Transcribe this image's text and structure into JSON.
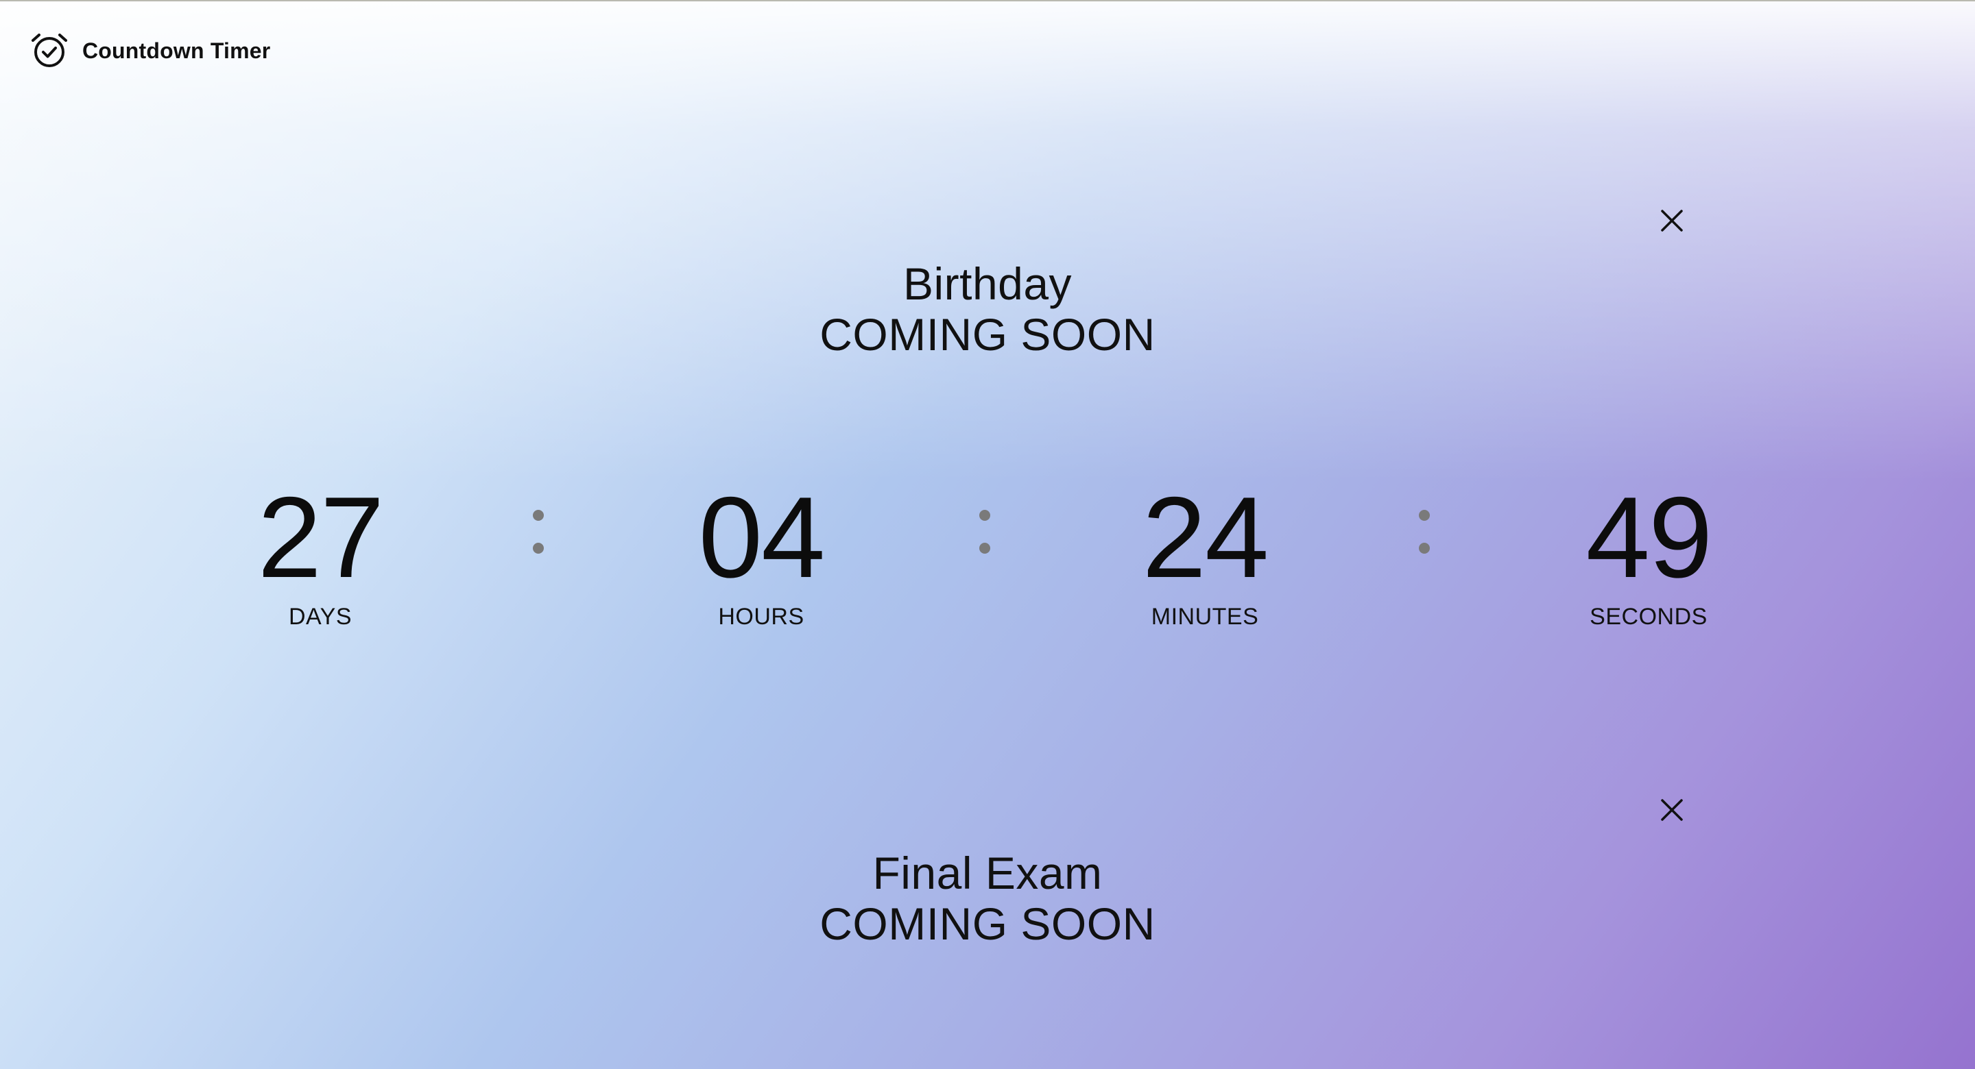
{
  "app": {
    "title": "Countdown Timer",
    "logo_icon": "alarm-clock-check-icon"
  },
  "countdowns": [
    {
      "title": "Birthday",
      "status": "COMING SOON",
      "close_icon": "close-icon",
      "timer": {
        "days": "27",
        "hours": "04",
        "minutes": "24",
        "seconds": "49",
        "labels": {
          "days": "DAYS",
          "hours": "HOURS",
          "minutes": "MINUTES",
          "seconds": "SECONDS"
        }
      }
    },
    {
      "title": "Final Exam",
      "status": "COMING SOON",
      "close_icon": "close-icon"
    }
  ],
  "colors": {
    "gradient_top_left": "#eef5fb",
    "gradient_mid": "#aec6ee",
    "gradient_bottom_right": "#9573cf",
    "separator_dot": "#7a7a7a"
  }
}
